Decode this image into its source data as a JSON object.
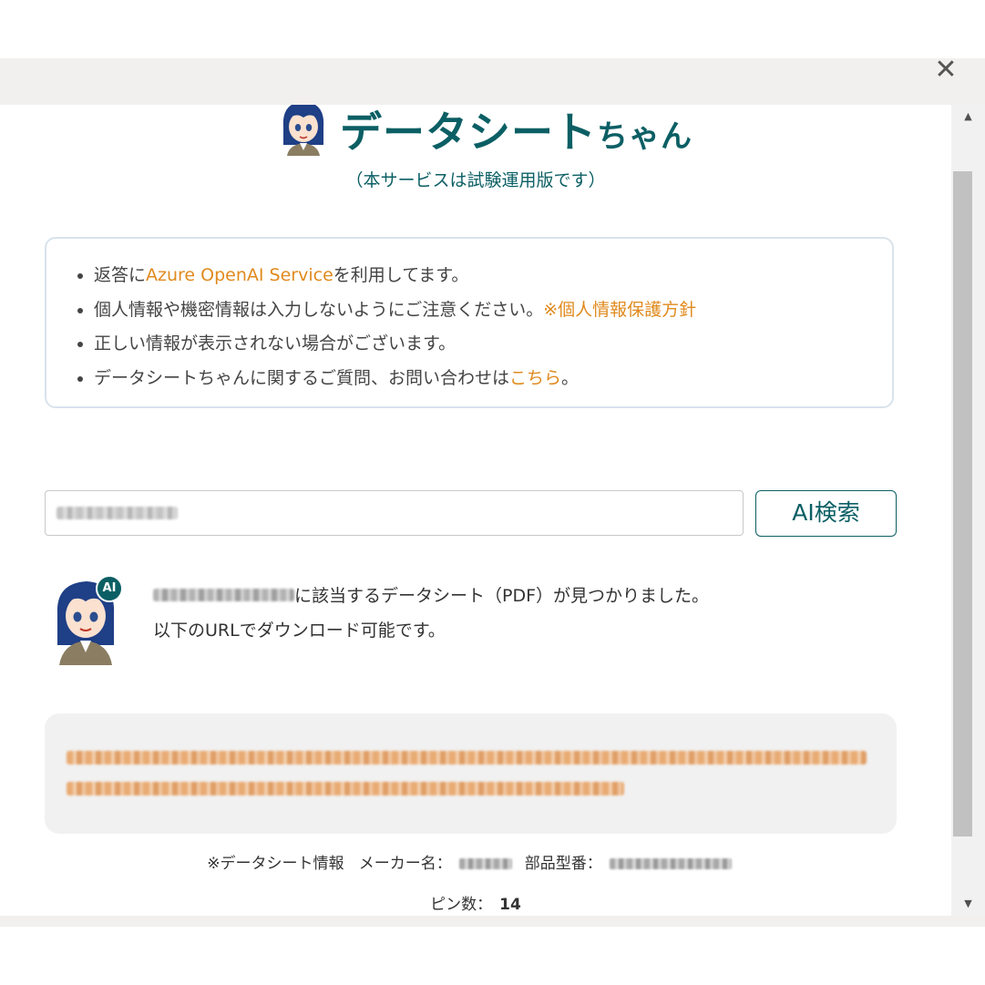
{
  "modal": {
    "close_glyph": "✕"
  },
  "scrollbar": {
    "up_glyph": "▲",
    "down_glyph": "▼"
  },
  "header": {
    "title_main": "データシート",
    "title_suffix": "ちゃん",
    "subtitle": "（本サービスは試験運用版です）",
    "avatar_icon": "character-avatar-icon"
  },
  "notice": {
    "item1_pre": "返答に",
    "item1_link": "Azure OpenAI Service",
    "item1_post": "を利用してます。",
    "item2_pre": "個人情報や機密情報は入力しないようにご注意ください。",
    "item2_link": "※個人情報保護方針",
    "item3": "正しい情報が表示されない場合がございます。",
    "item4_pre": "データシートちゃんに関するご質問、お問い合わせは",
    "item4_link": "こちら",
    "item4_post": "。"
  },
  "search": {
    "button_label": "AI検索"
  },
  "response": {
    "ai_badge": "AI",
    "line1": "に該当するデータシート（PDF）が見つかりました。",
    "line2": "以下のURLでダウンロード可能です。"
  },
  "datasheet_info": {
    "prefix": "※データシート情報",
    "maker_label": "メーカー名：",
    "part_label": "部品型番：",
    "pins_label": "ピン数：",
    "pins_value": "14"
  },
  "colors": {
    "accent": "#0b5f64",
    "link": "#e08a1e",
    "box_bg": "#f1f1f1"
  }
}
